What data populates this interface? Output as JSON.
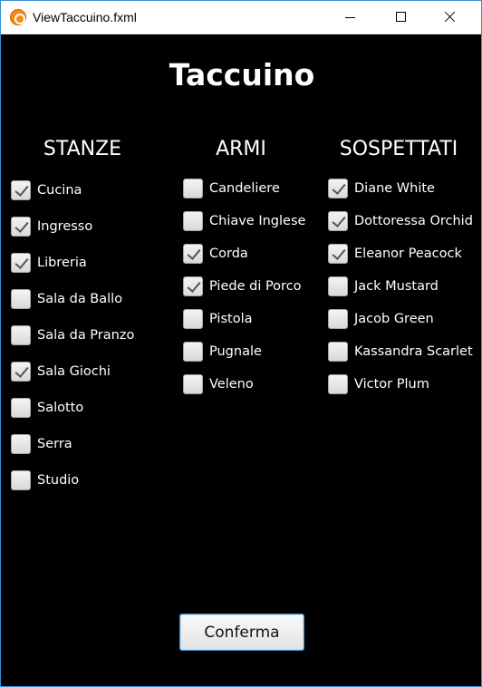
{
  "window": {
    "title": "ViewTaccuino.fxml"
  },
  "heading": "Taccuino",
  "columns": {
    "stanze": {
      "title": "STANZE",
      "items": [
        {
          "label": "Cucina",
          "checked": true
        },
        {
          "label": "Ingresso",
          "checked": true
        },
        {
          "label": "Libreria",
          "checked": true
        },
        {
          "label": "Sala da Ballo",
          "checked": false
        },
        {
          "label": "Sala da Pranzo",
          "checked": false
        },
        {
          "label": "Sala Giochi",
          "checked": true
        },
        {
          "label": "Salotto",
          "checked": false
        },
        {
          "label": "Serra",
          "checked": false
        },
        {
          "label": "Studio",
          "checked": false
        }
      ]
    },
    "armi": {
      "title": "ARMI",
      "items": [
        {
          "label": "Candeliere",
          "checked": false
        },
        {
          "label": "Chiave Inglese",
          "checked": false
        },
        {
          "label": "Corda",
          "checked": true
        },
        {
          "label": "Piede di Porco",
          "checked": true
        },
        {
          "label": "Pistola",
          "checked": false
        },
        {
          "label": "Pugnale",
          "checked": false
        },
        {
          "label": "Veleno",
          "checked": false
        }
      ]
    },
    "sospettati": {
      "title": "SOSPETTATI",
      "items": [
        {
          "label": "Diane White",
          "checked": true
        },
        {
          "label": "Dottoressa Orchid",
          "checked": true
        },
        {
          "label": "Eleanor Peacock",
          "checked": true
        },
        {
          "label": "Jack Mustard",
          "checked": false
        },
        {
          "label": "Jacob Green",
          "checked": false
        },
        {
          "label": "Kassandra Scarlet",
          "checked": false
        },
        {
          "label": "Victor Plum",
          "checked": false
        }
      ]
    }
  },
  "confirm_label": "Conferma",
  "icons": {
    "app": "app-icon",
    "minimize": "minimize-icon",
    "maximize": "maximize-icon",
    "close": "close-icon",
    "check": "checkmark-icon"
  }
}
